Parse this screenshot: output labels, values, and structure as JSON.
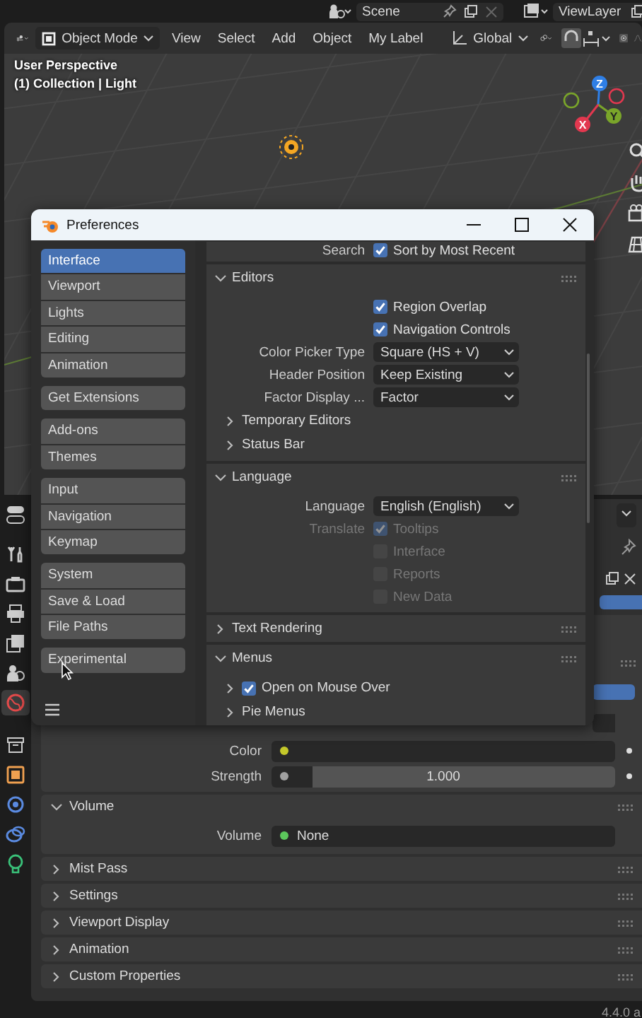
{
  "top_bar": {
    "scene": "Scene",
    "view_layer": "ViewLayer"
  },
  "viewport_header": {
    "mode": "Object Mode",
    "menus": [
      "View",
      "Select",
      "Add",
      "Object",
      "My Label"
    ],
    "orientation": "Global"
  },
  "viewport": {
    "overlay_lines": [
      "User Perspective",
      "(1) Collection | Light"
    ],
    "gizmo_axes": [
      {
        "label": "Z",
        "color": "#2f7fe6"
      },
      {
        "label": "Y",
        "color": "#7aa52a"
      },
      {
        "label": "X",
        "color": "#e2384f"
      }
    ]
  },
  "preferences": {
    "title": "Preferences",
    "sidebar": [
      [
        {
          "label": "Interface",
          "selected": true
        },
        {
          "label": "Viewport",
          "selected": false
        },
        {
          "label": "Lights",
          "selected": false
        },
        {
          "label": "Editing",
          "selected": false
        },
        {
          "label": "Animation",
          "selected": false
        }
      ],
      [
        {
          "label": "Get Extensions",
          "selected": false
        }
      ],
      [
        {
          "label": "Add-ons",
          "selected": false
        },
        {
          "label": "Themes",
          "selected": false
        }
      ],
      [
        {
          "label": "Input",
          "selected": false
        },
        {
          "label": "Navigation",
          "selected": false
        },
        {
          "label": "Keymap",
          "selected": false
        }
      ],
      [
        {
          "label": "System",
          "selected": false
        },
        {
          "label": "Save & Load",
          "selected": false
        },
        {
          "label": "File Paths",
          "selected": false
        }
      ],
      [
        {
          "label": "Experimental",
          "selected": false
        }
      ]
    ],
    "content": [
      {
        "kind": "checkbox",
        "label": "Search",
        "text": "Sort by Most Recent",
        "checked": true,
        "disabled": false
      },
      {
        "kind": "section",
        "title": "Editors",
        "expanded": true,
        "items": [
          {
            "kind": "checkbox",
            "text": "Region Overlap",
            "checked": true,
            "disabled": false
          },
          {
            "kind": "checkbox",
            "text": "Navigation Controls",
            "checked": true,
            "disabled": false
          },
          {
            "kind": "dropdown",
            "label": "Color Picker Type",
            "value": "Square (HS + V)"
          },
          {
            "kind": "dropdown",
            "label": "Header Position",
            "value": "Keep Existing"
          },
          {
            "kind": "dropdown",
            "label": "Factor Display ...",
            "value": "Factor"
          },
          {
            "kind": "subpanel",
            "text": "Temporary Editors",
            "expanded": false
          },
          {
            "kind": "subpanel",
            "text": "Status Bar",
            "expanded": false
          }
        ]
      },
      {
        "kind": "section",
        "title": "Language",
        "expanded": true,
        "items": [
          {
            "kind": "dropdown",
            "label": "Language",
            "value": "English (English)"
          },
          {
            "kind": "checkbox",
            "label": "Translate",
            "text": "Tooltips",
            "checked": true,
            "disabled": true
          },
          {
            "kind": "checkbox",
            "text": "Interface",
            "checked": false,
            "disabled": true
          },
          {
            "kind": "checkbox",
            "text": "Reports",
            "checked": false,
            "disabled": true
          },
          {
            "kind": "checkbox",
            "text": "New Data",
            "checked": false,
            "disabled": true
          }
        ]
      },
      {
        "kind": "section",
        "title": "Text Rendering",
        "expanded": false
      },
      {
        "kind": "section",
        "title": "Menus",
        "expanded": true,
        "items": [
          {
            "kind": "subpanel_check",
            "text": "Open on Mouse Over",
            "expanded": false,
            "checked": true
          },
          {
            "kind": "subpanel",
            "text": "Pie Menus",
            "expanded": false
          }
        ]
      }
    ]
  },
  "properties": {
    "tabs": [
      {
        "selected": false
      },
      {
        "selected": false
      },
      {
        "selected": false
      },
      {
        "selected": false
      },
      {
        "selected": false
      },
      {
        "selected": true
      },
      {
        "selected": false
      },
      {
        "selected": false
      },
      {
        "selected": false
      },
      {
        "selected": false
      },
      {
        "selected": false
      }
    ],
    "rows": [
      {
        "kind": "color",
        "label": "Color",
        "color": "#c4c82a"
      },
      {
        "kind": "number",
        "label": "Strength",
        "value": "1.000",
        "color": "#a0a0a0"
      }
    ],
    "panels": [
      {
        "title": "Volume",
        "expanded": true,
        "rows": [
          {
            "label": "Volume",
            "value": "None",
            "color": "#5cc75c"
          }
        ]
      },
      {
        "title": "Mist Pass",
        "expanded": false
      },
      {
        "title": "Settings",
        "expanded": false
      },
      {
        "title": "Viewport Display",
        "expanded": false
      },
      {
        "title": "Animation",
        "expanded": false
      },
      {
        "title": "Custom Properties",
        "expanded": false
      }
    ]
  },
  "status_bar": {
    "version": "4.4.0 a"
  }
}
